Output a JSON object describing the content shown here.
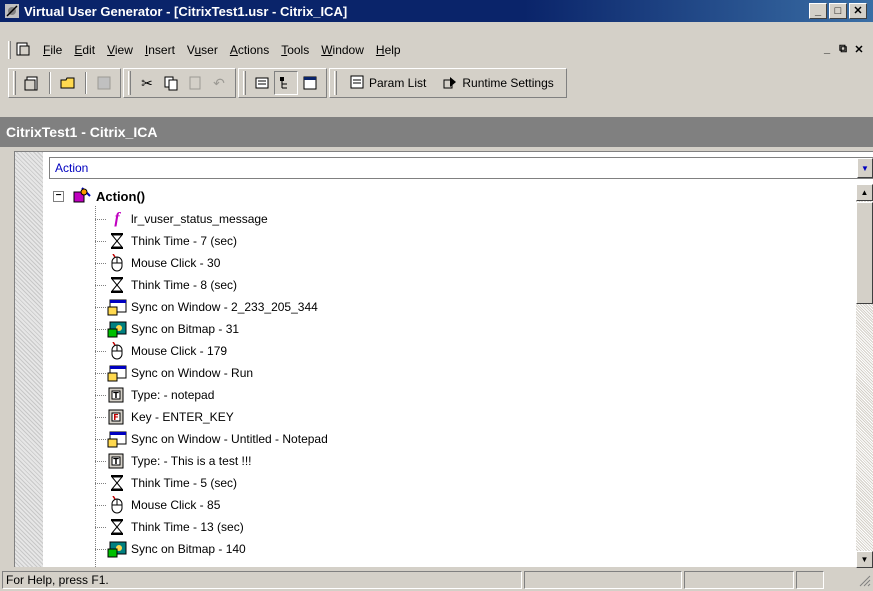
{
  "window": {
    "title": "Virtual User Generator - [CitrixTest1.usr - Citrix_ICA]"
  },
  "menu": [
    {
      "label": "File",
      "accel": "F"
    },
    {
      "label": "Edit",
      "accel": "E"
    },
    {
      "label": "View",
      "accel": "V"
    },
    {
      "label": "Insert",
      "accel": "I"
    },
    {
      "label": "Vuser",
      "accel": "u"
    },
    {
      "label": "Actions",
      "accel": "A"
    },
    {
      "label": "Tools",
      "accel": "T"
    },
    {
      "label": "Window",
      "accel": "W"
    },
    {
      "label": "Help",
      "accel": "H"
    }
  ],
  "toolbar": {
    "param_list": "Param List",
    "runtime_settings": "Runtime Settings"
  },
  "document": {
    "header": "CitrixTest1 - Citrix_ICA"
  },
  "section_combo": {
    "value": "Action"
  },
  "tree": {
    "root": "Action()",
    "items": [
      {
        "label": "lr_vuser_status_message",
        "icon": "function-icon"
      },
      {
        "label": "Think Time - 7 (sec)",
        "icon": "hourglass-icon"
      },
      {
        "label": "Mouse Click - 30",
        "icon": "mouse-icon"
      },
      {
        "label": "Think Time - 8 (sec)",
        "icon": "hourglass-icon"
      },
      {
        "label": "Sync on Window - 2_233_205_344",
        "icon": "sync-window-icon"
      },
      {
        "label": "Sync on Bitmap - 31",
        "icon": "sync-bitmap-icon"
      },
      {
        "label": "Mouse Click - 179",
        "icon": "mouse-icon"
      },
      {
        "label": "Sync on Window - Run",
        "icon": "sync-window-icon"
      },
      {
        "label": "Type: - notepad",
        "icon": "type-icon"
      },
      {
        "label": "Key - ENTER_KEY",
        "icon": "key-icon"
      },
      {
        "label": "Sync on Window - Untitled - Notepad",
        "icon": "sync-window-icon"
      },
      {
        "label": "Type: - This is a test !!!",
        "icon": "type-icon"
      },
      {
        "label": "Think Time - 5 (sec)",
        "icon": "hourglass-icon"
      },
      {
        "label": "Mouse Click - 85",
        "icon": "mouse-icon"
      },
      {
        "label": "Think Time - 13 (sec)",
        "icon": "hourglass-icon"
      },
      {
        "label": "Sync on Bitmap - 140",
        "icon": "sync-bitmap-icon"
      }
    ]
  },
  "status": {
    "help_text": "For Help, press F1."
  }
}
